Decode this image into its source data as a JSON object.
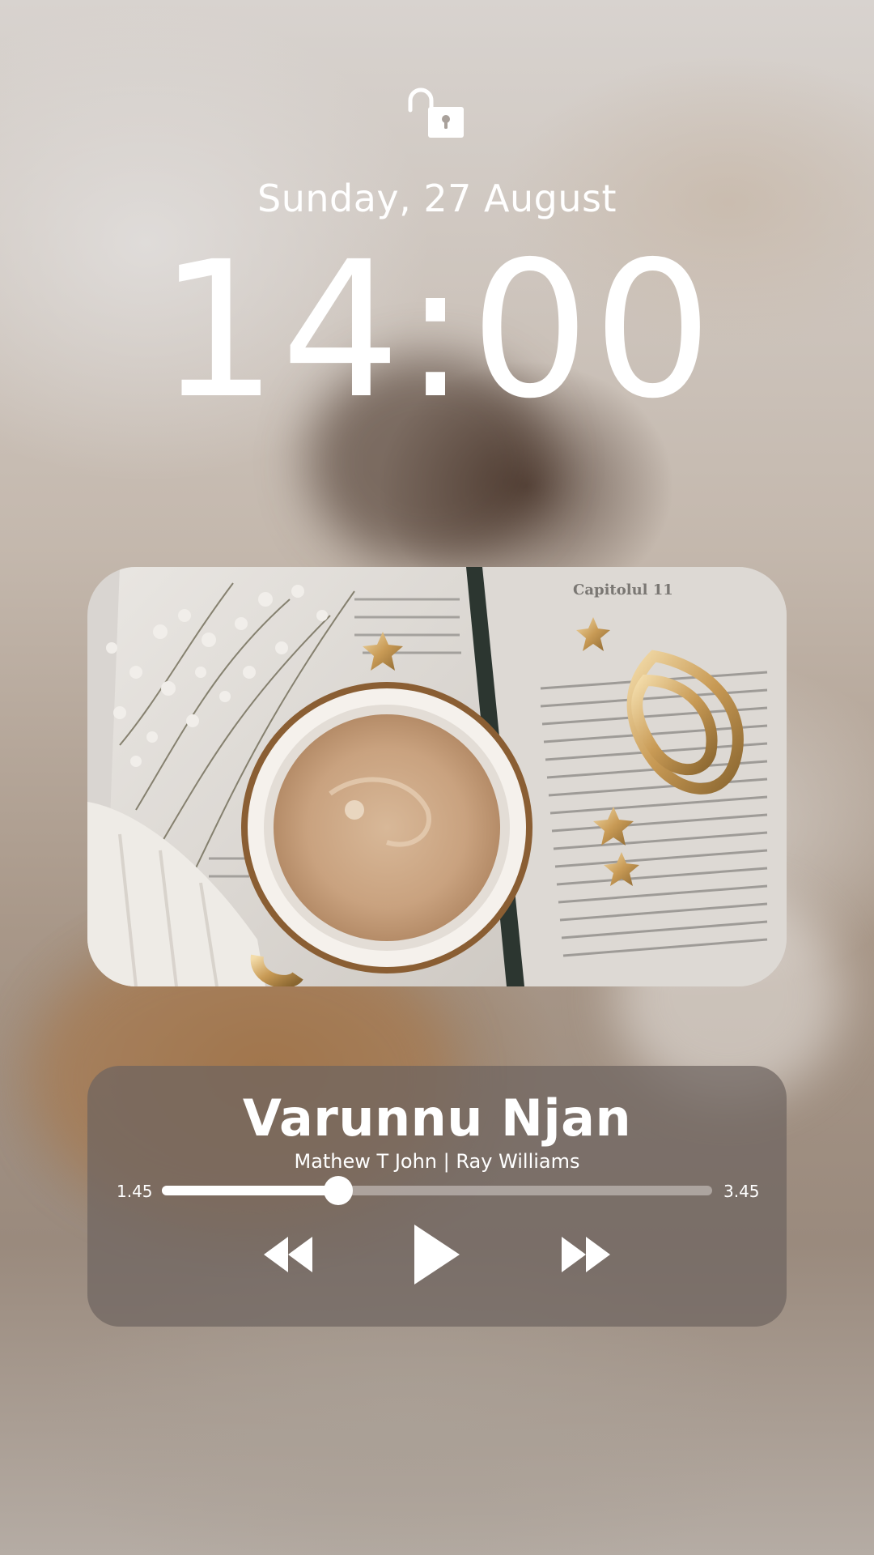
{
  "lockscreen": {
    "date": "Sunday, 27 August",
    "time": "14:00",
    "lock_icon": "unlocked-padlock-icon"
  },
  "now_playing": {
    "artwork_description_icon": "album-art",
    "title": "Varunnu Njan",
    "artist": "Mathew T John | Ray Williams",
    "elapsed": "1.45",
    "total": "3.45",
    "progress": 0.32,
    "controls": {
      "rewind_icon": "rewind-icon",
      "play_icon": "play-icon",
      "forward_icon": "fast-forward-icon"
    }
  },
  "colors": {
    "text": "#ffffff",
    "player_background": "#6e645f",
    "progress_track": "#beb6b2",
    "progress_fill": "#ffffff"
  }
}
